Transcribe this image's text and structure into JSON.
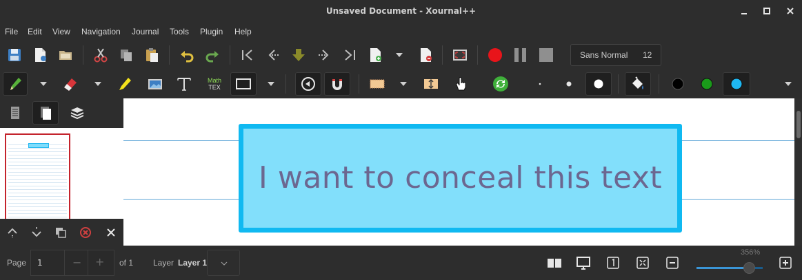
{
  "window": {
    "title": "Unsaved Document - Xournal++"
  },
  "menu": [
    "File",
    "Edit",
    "View",
    "Navigation",
    "Journal",
    "Tools",
    "Plugin",
    "Help"
  ],
  "font": {
    "name": "Sans Normal",
    "size": "12"
  },
  "colors": {
    "record": "#e8141a",
    "highlight_fill": "#82dffb",
    "highlight_border": "#10b9f1",
    "text": "#6c6790",
    "swatch_black": "#000000",
    "swatch_green": "#1a9a1a",
    "swatch_cyan": "#1eb8f3"
  },
  "toolbar2": {
    "math_label_top": "Math",
    "math_label_bottom": "TEX"
  },
  "document": {
    "text": "I want to conceal this text"
  },
  "status": {
    "page_label": "Page",
    "page_value": "1",
    "page_of": "of 1",
    "layer_label": "Layer",
    "layer_value": "Layer 1",
    "zoom": "356%",
    "zoom_fraction": 0.79
  }
}
